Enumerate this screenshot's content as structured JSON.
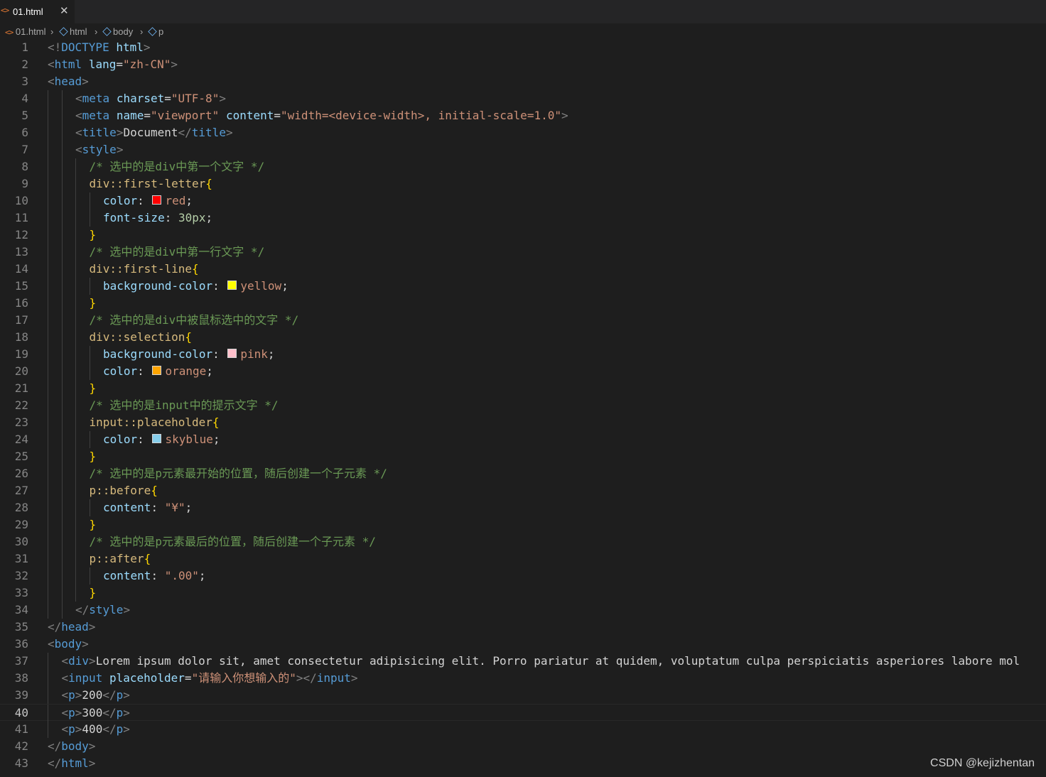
{
  "tab": {
    "name": "01.html",
    "icon": "<>",
    "close": "✕"
  },
  "breadcrumb": {
    "file": "01.html",
    "items": [
      "html",
      "body",
      "p"
    ]
  },
  "swatch_colors": {
    "red": "#ff0000",
    "yellow": "#ffff00",
    "pink": "#ffc0cb",
    "orange": "#ffa500",
    "skyblue": "#87ceeb"
  },
  "active_line": 40,
  "lines": [
    {
      "n": 1,
      "indent": 0,
      "t": [
        [
          "br",
          "<!"
        ],
        [
          "tag",
          "DOCTYPE"
        ],
        [
          "txt",
          " "
        ],
        [
          "attr",
          "html"
        ],
        [
          "br",
          ">"
        ]
      ]
    },
    {
      "n": 2,
      "indent": 0,
      "t": [
        [
          "br",
          "<"
        ],
        [
          "tag",
          "html"
        ],
        [
          "txt",
          " "
        ],
        [
          "attr",
          "lang"
        ],
        [
          "txt",
          "="
        ],
        [
          "str",
          "\"zh-CN\""
        ],
        [
          "br",
          ">"
        ]
      ]
    },
    {
      "n": 3,
      "indent": 0,
      "t": [
        [
          "br",
          "<"
        ],
        [
          "tag",
          "head"
        ],
        [
          "br",
          ">"
        ]
      ]
    },
    {
      "n": 4,
      "indent": 2,
      "t": [
        [
          "br",
          "<"
        ],
        [
          "tag",
          "meta"
        ],
        [
          "txt",
          " "
        ],
        [
          "attr",
          "charset"
        ],
        [
          "txt",
          "="
        ],
        [
          "str",
          "\"UTF-8\""
        ],
        [
          "br",
          ">"
        ]
      ]
    },
    {
      "n": 5,
      "indent": 2,
      "t": [
        [
          "br",
          "<"
        ],
        [
          "tag",
          "meta"
        ],
        [
          "txt",
          " "
        ],
        [
          "attr",
          "name"
        ],
        [
          "txt",
          "="
        ],
        [
          "str",
          "\"viewport\""
        ],
        [
          "txt",
          " "
        ],
        [
          "attr",
          "content"
        ],
        [
          "txt",
          "="
        ],
        [
          "str",
          "\"width=<device-width>, initial-scale=1.0\""
        ],
        [
          "br",
          ">"
        ]
      ]
    },
    {
      "n": 6,
      "indent": 2,
      "t": [
        [
          "br",
          "<"
        ],
        [
          "tag",
          "title"
        ],
        [
          "br",
          ">"
        ],
        [
          "txt",
          "Document"
        ],
        [
          "br",
          "</"
        ],
        [
          "tag",
          "title"
        ],
        [
          "br",
          ">"
        ]
      ]
    },
    {
      "n": 7,
      "indent": 2,
      "t": [
        [
          "br",
          "<"
        ],
        [
          "tag",
          "style"
        ],
        [
          "br",
          ">"
        ]
      ]
    },
    {
      "n": 8,
      "indent": 3,
      "t": [
        [
          "cmt",
          "/* 选中的是div中第一个文字 */"
        ]
      ]
    },
    {
      "n": 9,
      "indent": 3,
      "t": [
        [
          "sel",
          "div::first-letter"
        ],
        [
          "brace",
          "{"
        ]
      ]
    },
    {
      "n": 10,
      "indent": 4,
      "t": [
        [
          "attr",
          "color"
        ],
        [
          "txt",
          ": "
        ],
        [
          "sw",
          "red"
        ],
        [
          "str",
          "red"
        ],
        [
          "txt",
          ";"
        ]
      ]
    },
    {
      "n": 11,
      "indent": 4,
      "t": [
        [
          "attr",
          "font-size"
        ],
        [
          "txt",
          ": "
        ],
        [
          "num",
          "30px"
        ],
        [
          "txt",
          ";"
        ]
      ]
    },
    {
      "n": 12,
      "indent": 3,
      "t": [
        [
          "brace",
          "}"
        ]
      ]
    },
    {
      "n": 13,
      "indent": 3,
      "t": [
        [
          "cmt",
          "/* 选中的是div中第一行文字 */"
        ]
      ]
    },
    {
      "n": 14,
      "indent": 3,
      "t": [
        [
          "sel",
          "div::first-line"
        ],
        [
          "brace",
          "{"
        ]
      ]
    },
    {
      "n": 15,
      "indent": 4,
      "t": [
        [
          "attr",
          "background-color"
        ],
        [
          "txt",
          ": "
        ],
        [
          "sw",
          "yellow"
        ],
        [
          "str",
          "yellow"
        ],
        [
          "txt",
          ";"
        ]
      ]
    },
    {
      "n": 16,
      "indent": 3,
      "t": [
        [
          "brace",
          "}"
        ]
      ]
    },
    {
      "n": 17,
      "indent": 3,
      "t": [
        [
          "cmt",
          "/* 选中的是div中被鼠标选中的文字 */"
        ]
      ]
    },
    {
      "n": 18,
      "indent": 3,
      "t": [
        [
          "sel",
          "div::selection"
        ],
        [
          "brace",
          "{"
        ]
      ]
    },
    {
      "n": 19,
      "indent": 4,
      "t": [
        [
          "attr",
          "background-color"
        ],
        [
          "txt",
          ": "
        ],
        [
          "sw",
          "pink"
        ],
        [
          "str",
          "pink"
        ],
        [
          "txt",
          ";"
        ]
      ]
    },
    {
      "n": 20,
      "indent": 4,
      "t": [
        [
          "attr",
          "color"
        ],
        [
          "txt",
          ": "
        ],
        [
          "sw",
          "orange"
        ],
        [
          "str",
          "orange"
        ],
        [
          "txt",
          ";"
        ]
      ]
    },
    {
      "n": 21,
      "indent": 3,
      "t": [
        [
          "brace",
          "}"
        ]
      ]
    },
    {
      "n": 22,
      "indent": 3,
      "t": [
        [
          "cmt",
          "/* 选中的是input中的提示文字 */"
        ]
      ]
    },
    {
      "n": 23,
      "indent": 3,
      "t": [
        [
          "sel",
          "input::placeholder"
        ],
        [
          "brace",
          "{"
        ]
      ]
    },
    {
      "n": 24,
      "indent": 4,
      "t": [
        [
          "attr",
          "color"
        ],
        [
          "txt",
          ": "
        ],
        [
          "sw",
          "skyblue"
        ],
        [
          "str",
          "skyblue"
        ],
        [
          "txt",
          ";"
        ]
      ]
    },
    {
      "n": 25,
      "indent": 3,
      "t": [
        [
          "brace",
          "}"
        ]
      ]
    },
    {
      "n": 26,
      "indent": 3,
      "t": [
        [
          "cmt",
          "/* 选中的是p元素最开始的位置，随后创建一个子元素 */"
        ]
      ]
    },
    {
      "n": 27,
      "indent": 3,
      "t": [
        [
          "sel",
          "p::before"
        ],
        [
          "brace",
          "{"
        ]
      ]
    },
    {
      "n": 28,
      "indent": 4,
      "t": [
        [
          "attr",
          "content"
        ],
        [
          "txt",
          ": "
        ],
        [
          "str",
          "\"¥\""
        ],
        [
          "txt",
          ";"
        ]
      ]
    },
    {
      "n": 29,
      "indent": 3,
      "t": [
        [
          "brace",
          "}"
        ]
      ]
    },
    {
      "n": 30,
      "indent": 3,
      "t": [
        [
          "cmt",
          "/* 选中的是p元素最后的位置，随后创建一个子元素 */"
        ]
      ]
    },
    {
      "n": 31,
      "indent": 3,
      "t": [
        [
          "sel",
          "p::after"
        ],
        [
          "brace",
          "{"
        ]
      ]
    },
    {
      "n": 32,
      "indent": 4,
      "t": [
        [
          "attr",
          "content"
        ],
        [
          "txt",
          ": "
        ],
        [
          "str",
          "\".00\""
        ],
        [
          "txt",
          ";"
        ]
      ]
    },
    {
      "n": 33,
      "indent": 3,
      "t": [
        [
          "brace",
          "}"
        ]
      ]
    },
    {
      "n": 34,
      "indent": 2,
      "t": [
        [
          "br",
          "</"
        ],
        [
          "tag",
          "style"
        ],
        [
          "br",
          ">"
        ]
      ]
    },
    {
      "n": 35,
      "indent": 0,
      "t": [
        [
          "br",
          "</"
        ],
        [
          "tag",
          "head"
        ],
        [
          "br",
          ">"
        ]
      ]
    },
    {
      "n": 36,
      "indent": 0,
      "t": [
        [
          "br",
          "<"
        ],
        [
          "tag",
          "body"
        ],
        [
          "br",
          ">"
        ]
      ]
    },
    {
      "n": 37,
      "indent": 1,
      "t": [
        [
          "br",
          "<"
        ],
        [
          "tag",
          "div"
        ],
        [
          "br",
          ">"
        ],
        [
          "txt",
          "Lorem ipsum dolor sit, amet consectetur adipisicing elit. Porro pariatur at quidem, voluptatum culpa perspiciatis asperiores labore mol"
        ]
      ]
    },
    {
      "n": 38,
      "indent": 1,
      "t": [
        [
          "br",
          "<"
        ],
        [
          "tag",
          "input"
        ],
        [
          "txt",
          " "
        ],
        [
          "attr",
          "placeholder"
        ],
        [
          "txt",
          "="
        ],
        [
          "str",
          "\"请输入你想输入的\""
        ],
        [
          "br",
          "></"
        ],
        [
          "tag",
          "input"
        ],
        [
          "br",
          ">"
        ]
      ]
    },
    {
      "n": 39,
      "indent": 1,
      "t": [
        [
          "br",
          "<"
        ],
        [
          "tag",
          "p"
        ],
        [
          "br",
          ">"
        ],
        [
          "txt",
          "200"
        ],
        [
          "br",
          "</"
        ],
        [
          "tag",
          "p"
        ],
        [
          "br",
          ">"
        ]
      ]
    },
    {
      "n": 40,
      "indent": 1,
      "t": [
        [
          "br",
          "<"
        ],
        [
          "tag",
          "p"
        ],
        [
          "br",
          ">"
        ],
        [
          "txt",
          "300"
        ],
        [
          "br",
          "</"
        ],
        [
          "tag",
          "p"
        ],
        [
          "br",
          ">"
        ]
      ]
    },
    {
      "n": 41,
      "indent": 1,
      "t": [
        [
          "br",
          "<"
        ],
        [
          "tag",
          "p"
        ],
        [
          "br",
          ">"
        ],
        [
          "txt",
          "400"
        ],
        [
          "br",
          "</"
        ],
        [
          "tag",
          "p"
        ],
        [
          "br",
          ">"
        ]
      ]
    },
    {
      "n": 42,
      "indent": 0,
      "t": [
        [
          "br",
          "</"
        ],
        [
          "tag",
          "body"
        ],
        [
          "br",
          ">"
        ]
      ]
    },
    {
      "n": 43,
      "indent": 0,
      "t": [
        [
          "br",
          "</"
        ],
        [
          "tag",
          "html"
        ],
        [
          "br",
          ">"
        ]
      ]
    }
  ],
  "watermark": "CSDN @kejizhentan"
}
